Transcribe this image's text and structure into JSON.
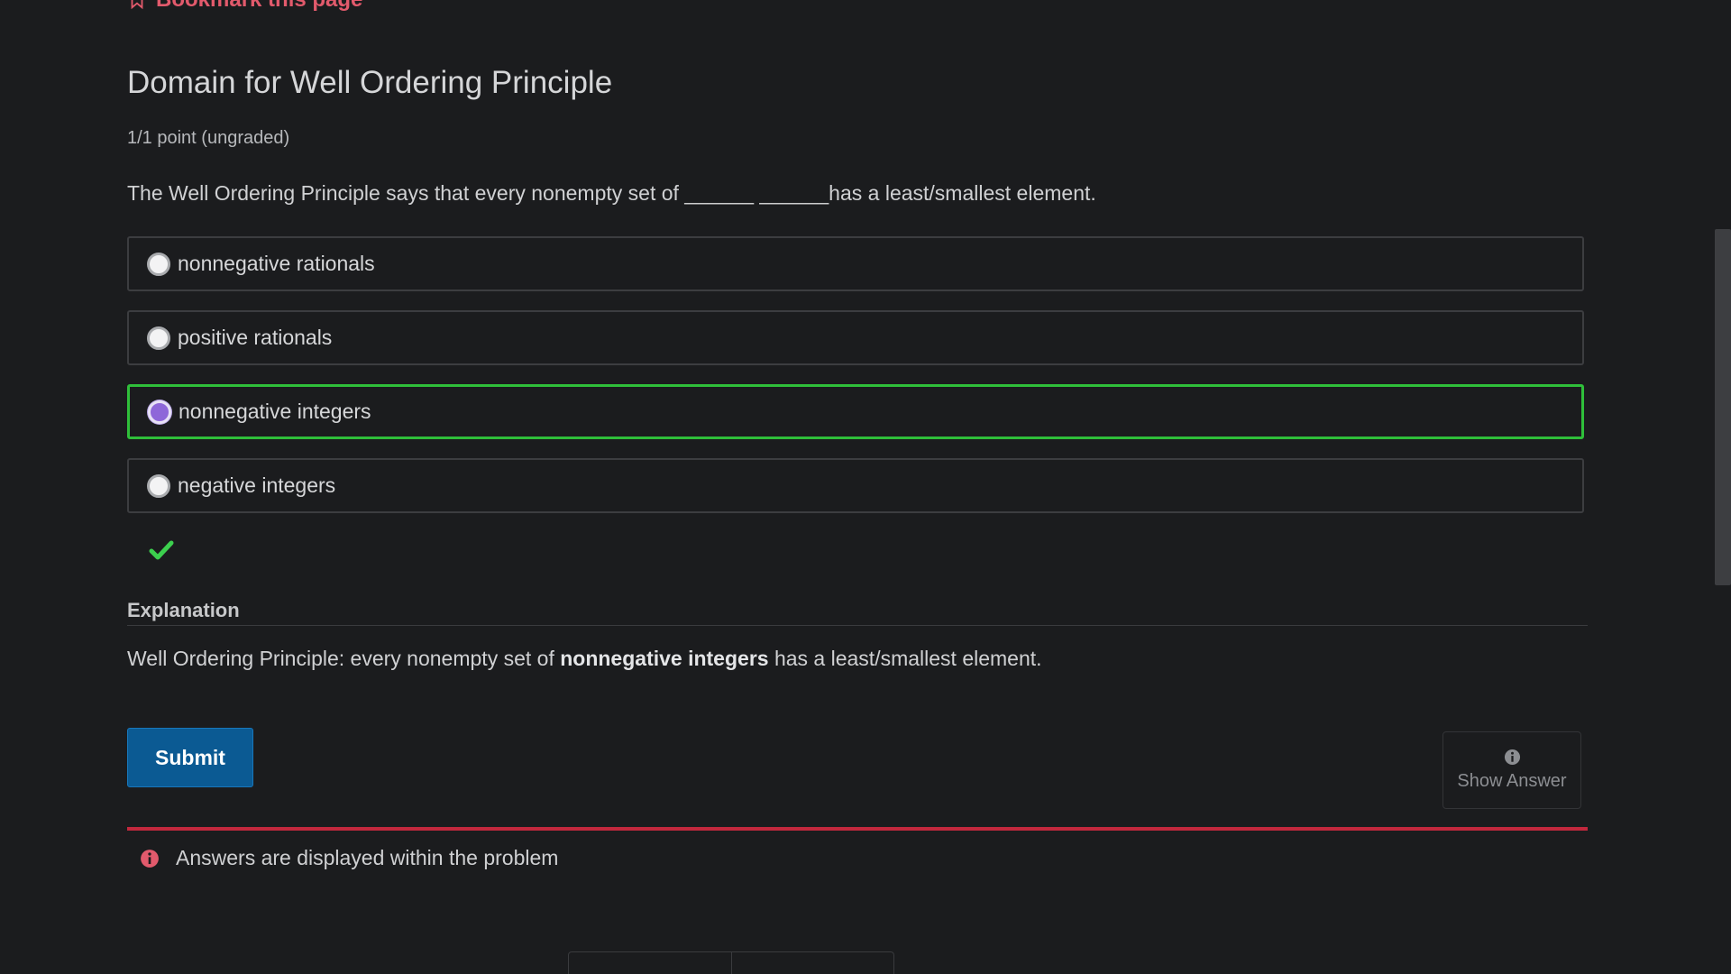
{
  "bookmark": {
    "label": "Bookmark this page"
  },
  "problem": {
    "title": "Domain for Well Ordering Principle",
    "points": "1/1 point (ungraded)",
    "question": "The Well Ordering Principle says that every nonempty set of ______ ______has a least/smallest element."
  },
  "options": [
    {
      "label": "nonnegative rationals",
      "selected": false
    },
    {
      "label": "positive rationals",
      "selected": false
    },
    {
      "label": "nonnegative integers",
      "selected": true,
      "status": "correct"
    },
    {
      "label": "negative integers",
      "selected": false
    }
  ],
  "result": {
    "icon": "checkmark-icon",
    "status": "correct"
  },
  "explanation": {
    "heading": "Explanation",
    "text_before": "Well Ordering Principle: every nonempty set of ",
    "text_bold": "nonnegative integers",
    "text_after": " has a least/smallest element."
  },
  "actions": {
    "submit_label": "Submit",
    "show_answer_label": "Show Answer"
  },
  "notice": {
    "text": "Answers are displayed within the problem"
  },
  "colors": {
    "accent_red": "#e25a6c",
    "correct_green": "#2fbf3a",
    "submit_blue": "#0b5a93",
    "radio_selected": "#8e67d9",
    "background": "#1b1c1e"
  }
}
